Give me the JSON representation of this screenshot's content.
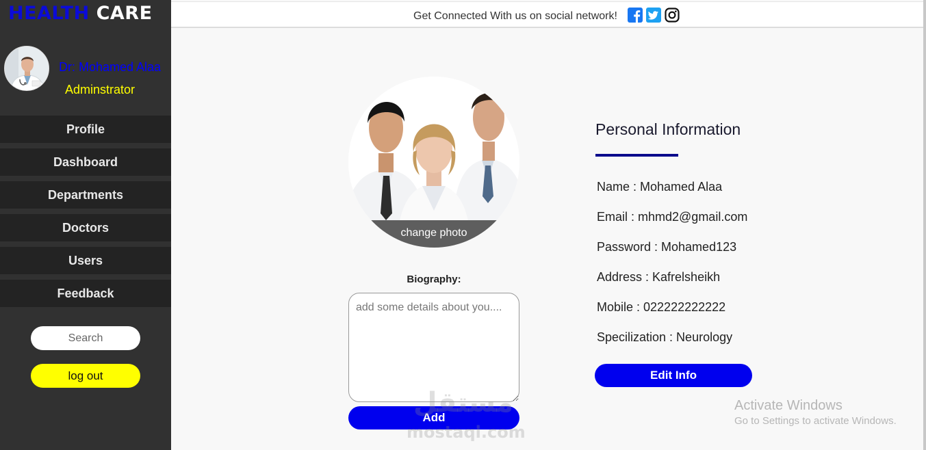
{
  "brand": {
    "part1": "HEALTH",
    "part2": "CARE"
  },
  "user": {
    "name": "Dr: Mohamed Alaa",
    "role": "Adminstrator"
  },
  "sidebar": {
    "items": [
      {
        "label": "Profile"
      },
      {
        "label": "Dashboard"
      },
      {
        "label": "Departments"
      },
      {
        "label": "Doctors"
      },
      {
        "label": "Users"
      },
      {
        "label": "Feedback"
      }
    ],
    "search_placeholder": "Search",
    "logout_label": "log out"
  },
  "topbar": {
    "connect_text": "Get Connected With us on social network!",
    "social_icons": [
      "facebook-icon",
      "twitter-icon",
      "instagram-icon"
    ]
  },
  "profile": {
    "change_photo_label": "change photo",
    "bio_label": "Biography:",
    "bio_placeholder": "add some details about you....",
    "add_label": "Add"
  },
  "personal_info": {
    "title": "Personal Information",
    "rows": [
      "Name : Mohamed Alaa",
      "Email : mhmd2@gmail.com",
      "Password : Mohamed123",
      "Address : Kafrelsheikh",
      "Mobile : 022222222222",
      "Specilization : Neurology"
    ],
    "edit_label": "Edit Info"
  },
  "windows_notice": {
    "title": "Activate Windows",
    "subtitle": "Go to Settings to activate Windows."
  },
  "watermark": {
    "arabic": "مستقل",
    "latin": "mostaql.com"
  },
  "colors": {
    "sidebar_bg": "#313131",
    "nav_item_bg": "#232323",
    "accent_blue": "#0000ee",
    "logout_yellow": "#ffff00",
    "facebook": "#1877f2",
    "twitter": "#1da1f2"
  }
}
